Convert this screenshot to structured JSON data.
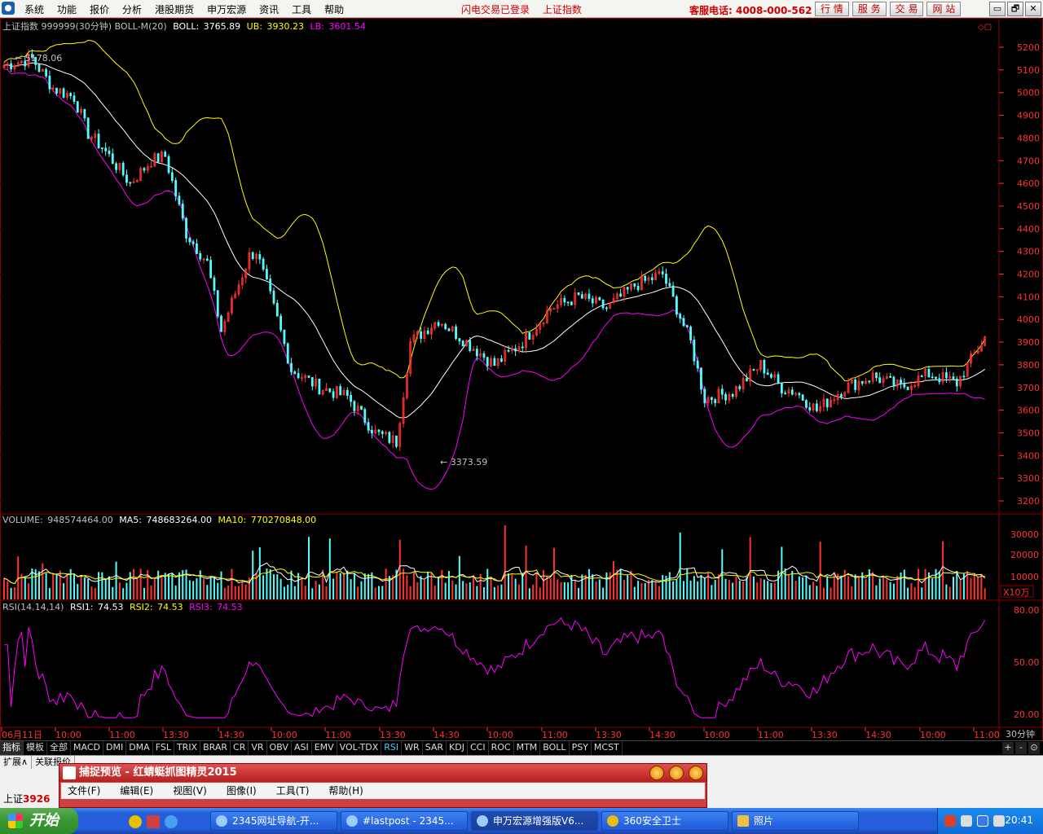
{
  "menu": {
    "items": [
      "系统",
      "功能",
      "报价",
      "分析",
      "港股期货",
      "申万宏源",
      "资讯",
      "工具",
      "帮助"
    ],
    "status_login": "闪电交易已登录",
    "status_index": "上证指数",
    "service": "客服电话: 4008-000-562",
    "buttons": [
      "行 情",
      "服 务",
      "交 易",
      "网 站"
    ],
    "win_controls": [
      "▭",
      "🗗",
      "✕"
    ]
  },
  "chart_header": {
    "label": "上证指数 999999(30分钟) BOLL-M(20)",
    "boll_label": "BOLL:",
    "boll": "3765.89",
    "ub_label": "UB:",
    "ub": "3930.23",
    "lb_label": "LB:",
    "lb": "3601.54"
  },
  "price_axis": {
    "labels": [
      "5200",
      "5100",
      "5000",
      "4900",
      "4800",
      "4700",
      "4600",
      "4500",
      "4400",
      "4300",
      "4200",
      "4100",
      "4000",
      "3900",
      "3800",
      "3700",
      "3600",
      "3500",
      "3400",
      "3300",
      "3200"
    ]
  },
  "annotations": {
    "high": "5178.06",
    "low": "3373.59"
  },
  "volume_header": {
    "label": "VOLUME:",
    "volume": "948574464.00",
    "ma5_label": "MA5:",
    "ma5": "748683264.00",
    "ma10_label": "MA10:",
    "ma10": "770270848.00",
    "unit": "X10万",
    "axis": [
      "30000",
      "20000",
      "10000"
    ]
  },
  "rsi_header": {
    "label": "RSI(14,14,14)",
    "rsi1_label": "RSI1:",
    "rsi1": "74.53",
    "rsi2_label": "RSI2:",
    "rsi2": "74.53",
    "rsi3_label": "RSI3:",
    "rsi3": "74.53",
    "axis": [
      "80.00",
      "50.00",
      "20.00"
    ]
  },
  "time_axis": {
    "labels": [
      "06月11日",
      "10:00",
      "11:00",
      "13:30",
      "14:30",
      "10:00",
      "11:00",
      "13:30",
      "14:30",
      "10:00",
      "11:00",
      "13:30",
      "14:30",
      "10:00",
      "11:00",
      "13:30",
      "14:30",
      "10:00",
      "11:00"
    ],
    "period": "30分钟"
  },
  "indicator_tabs": [
    "指标",
    "模板",
    "全部",
    "MACD",
    "DMI",
    "DMA",
    "FSL",
    "TRIX",
    "BRAR",
    "CR",
    "VR",
    "OBV",
    "ASI",
    "EMV",
    "VOL-TDX",
    "RSI",
    "WR",
    "SAR",
    "KDJ",
    "CCI",
    "ROC",
    "MTM",
    "BOLL",
    "PSY",
    "MCST"
  ],
  "tab_controls": [
    "+",
    "-",
    "⊙"
  ],
  "ext_tabs": [
    "扩展∧",
    "关联报价"
  ],
  "bottom_quote": {
    "name": "上证",
    "value": "3926"
  },
  "capture_window": {
    "title": "捕捉预览 - 红蜻蜓抓图精灵2015",
    "menu": [
      "文件(F)",
      "编辑(E)",
      "视图(V)",
      "图像(I)",
      "工具(T)",
      "帮助(H)"
    ]
  },
  "taskbar": {
    "start": "开始",
    "tasks": [
      "2345网址导航-开...",
      "#lastpost - 2345...",
      "申万宏源增强版V6...",
      "360安全卫士",
      "照片"
    ],
    "clock": "20:41"
  },
  "colors": {
    "up": "#ff3232",
    "down": "#54fcfc",
    "ma_mid": "#ffffff",
    "ub": "#ffff00",
    "lb": "#ff00ff",
    "rsi": "#ff00ff",
    "grid": "#8b0000"
  }
}
